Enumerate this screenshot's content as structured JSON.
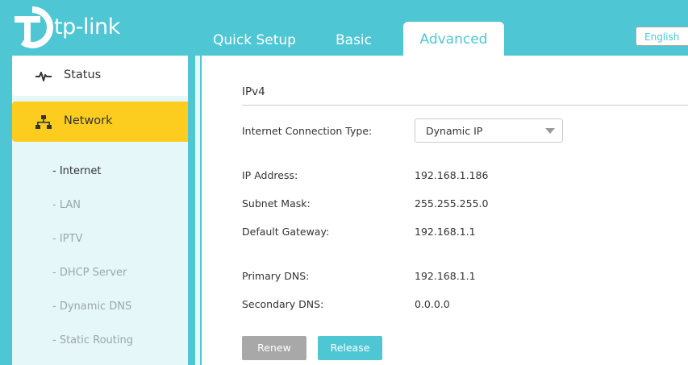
{
  "brand": {
    "logo_text": "tp-link"
  },
  "nav": {
    "tabs": [
      {
        "label": "Quick Setup"
      },
      {
        "label": "Basic"
      },
      {
        "label": "Advanced"
      }
    ],
    "language": "English"
  },
  "sidebar": {
    "items": [
      {
        "label": "Status",
        "icon": "pulse-icon"
      },
      {
        "label": "Network",
        "icon": "network-topology-icon"
      }
    ],
    "subitems": [
      {
        "label": "- Internet"
      },
      {
        "label": "- LAN"
      },
      {
        "label": "- IPTV"
      },
      {
        "label": "- DHCP Server"
      },
      {
        "label": "- Dynamic DNS"
      },
      {
        "label": "- Static Routing"
      }
    ]
  },
  "main": {
    "section_title": "IPv4",
    "connection_type": {
      "label": "Internet Connection Type:",
      "value": "Dynamic IP"
    },
    "fields": [
      {
        "label": "IP Address:",
        "value": "192.168.1.186"
      },
      {
        "label": "Subnet Mask:",
        "value": "255.255.255.0"
      },
      {
        "label": "Default Gateway:",
        "value": "192.168.1.1"
      },
      {
        "label": "Primary DNS:",
        "value": "192.168.1.1"
      },
      {
        "label": "Secondary DNS:",
        "value": "0.0.0.0"
      }
    ],
    "buttons": {
      "renew": "Renew",
      "release": "Release"
    }
  },
  "colors": {
    "accent": "#4fc6d4",
    "network_highlight": "#fccc1f",
    "sidebar_bg": "#e6f7fa"
  }
}
